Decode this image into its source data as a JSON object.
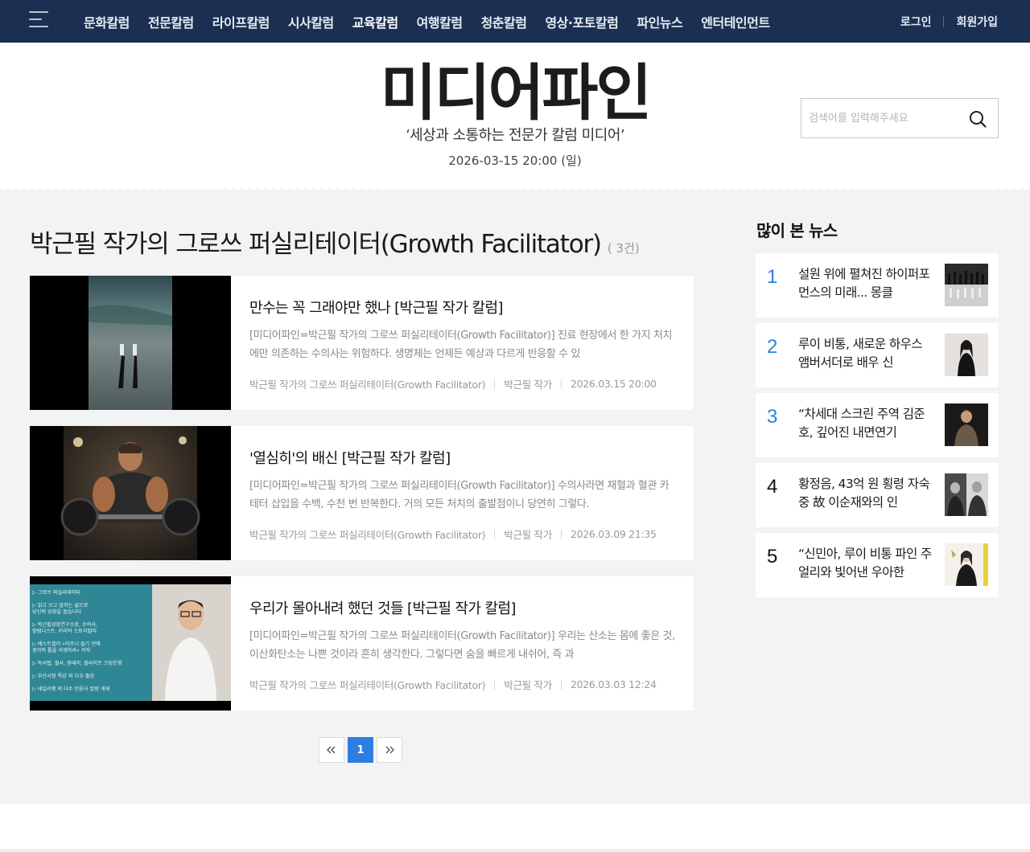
{
  "nav": {
    "items": [
      {
        "label": "문화칼럼"
      },
      {
        "label": "전문칼럼"
      },
      {
        "label": "라이프칼럼"
      },
      {
        "label": "시사칼럼"
      },
      {
        "label": "교육칼럼"
      },
      {
        "label": "여행칼럼"
      },
      {
        "label": "청춘칼럼"
      },
      {
        "label": "영상·포토칼럼"
      },
      {
        "label": "파인뉴스"
      },
      {
        "label": "엔터테인먼트"
      }
    ],
    "active_index": 4,
    "login_label": "로그인",
    "signup_label": "회원가입"
  },
  "header": {
    "logo_text": "미디어파인",
    "tagline": "‘세상과 소통하는 전문가 칼럼 미디어’",
    "date": "2026-03-15 20:00 (일)"
  },
  "search": {
    "placeholder": "검색어를 입력해주세요",
    "icon": "search-icon"
  },
  "section": {
    "title": "박근필 작가의 그로쓰 퍼실리테이터(Growth Facilitator)",
    "count": "( 3건)"
  },
  "articles": [
    {
      "title": "만수는 꼭 그래야만 했나 [박근필 작가 칼럼]",
      "excerpt": "[미디어파인=박근필 작가의 그로쓰 퍼실리테이터(Growth Facilitator)] 진료 현장에서 한 가지 처치에만 의존하는 수의사는 위험하다. 생명체는 언제든 예상과 다르게 반응할 수 있",
      "category": "박근필 작가의 그로쓰 퍼실리테이터(Growth Facilitator)",
      "author": "박근필 작가",
      "date": "2026.03.15 20:00"
    },
    {
      "title": "'열심히'의 배신 [박근필 작가 칼럼]",
      "excerpt": "[미디어파인=박근필 작가의 그로쓰 퍼실리테이터(Growth Facilitator)] 수의사라면 채혈과 혈관 카테터 삽입을 수백, 수천 번 반복한다. 거의 모든 처치의 출발점이니 당연히 그렇다.",
      "category": "박근필 작가의 그로쓰 퍼실리테이터(Growth Facilitator)",
      "author": "박근필 작가",
      "date": "2026.03.09 21:35"
    },
    {
      "title": "우리가 몰아내려 했던 것들 [박근필 작가 칼럼]",
      "excerpt": "[미디어파인=박근필 작가의 그로쓰 퍼실리테이터(Growth Facilitator)] 우리는 산소는 몸에 좋은 것, 이산화탄소는 나쁜 것이라 흔히 생각한다. 그렇다면 숨을 빠르게 내쉬어, 즉 과",
      "category": "박근필 작가의 그로쓰 퍼실리테이터(Growth Facilitator)",
      "author": "박근필 작가",
      "date": "2026.03.03 12:24"
    }
  ],
  "thumb3_lines": [
    "▷ 그로쓰 퍼실리테이터",
    "▷ 읽고 쓰고 말하는 삶으로",
    "   당신의 성장을 돕습니다",
    "▷ 박근필성장연구소장, 수의사,",
    "   칼럼니스트, 커리어 스토리텔러",
    "▷ 베스트셀러 «아프니 들기 전에",
    "   생각의 틀을 리셋하라» 저자",
    "▷ 독서법, 필사, 원데이, 필라이프 코칭운영",
    "▷ 부산시청 특강 외 다수 출강",
    "▷ 데일리펫 외 다수 언론사 칼럼 게재"
  ],
  "pagination": {
    "prev_icon": "double-chevron-left-icon",
    "current": "1",
    "next_icon": "double-chevron-right-icon"
  },
  "popular": {
    "title": "많이 본 뉴스",
    "items": [
      {
        "rank": "1",
        "text": "설원 위에 펼쳐진 하이퍼포먼스의 미래... 몽클"
      },
      {
        "rank": "2",
        "text": "루이 비통, 새로운 하우스 앰버서더로 배우 신"
      },
      {
        "rank": "3",
        "text": "“차세대 스크린 주역 김준호, 깊어진 내면연기"
      },
      {
        "rank": "4",
        "text": "황정음, 43억 원 횡령 자숙 중 故 이순재와의 인"
      },
      {
        "rank": "5",
        "text": "“신민아, 루이 비통 파인 주얼리와 빛어낸 우아한"
      }
    ]
  },
  "colors": {
    "nav_bg": "#1a2f52",
    "accent": "#2d7ee2",
    "page_bg": "#f2f3f3"
  }
}
